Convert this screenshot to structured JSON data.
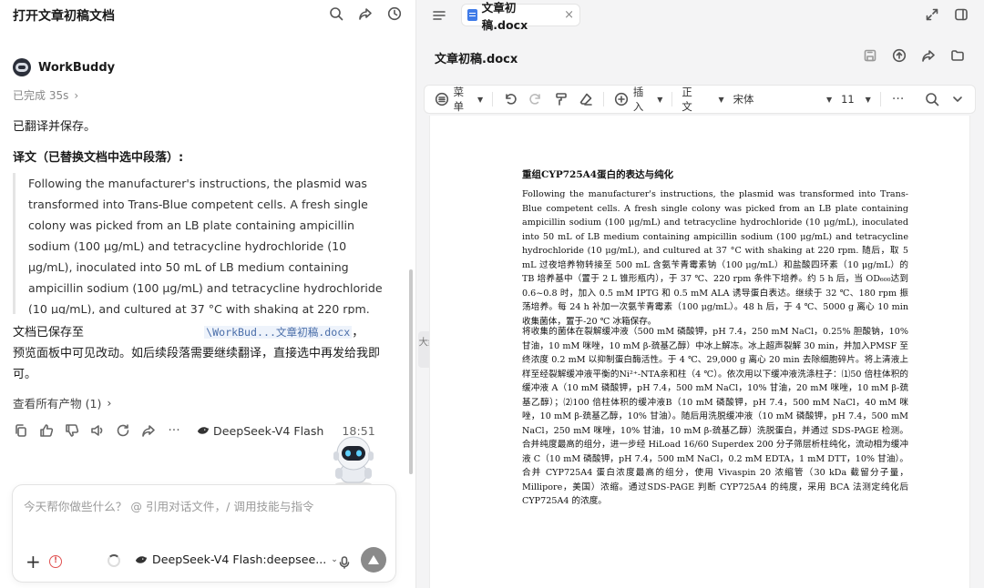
{
  "left": {
    "header_title": "打开文章初稿文档",
    "agent_name": "WorkBuddy",
    "status": "已完成 35s",
    "translated_saved": "已翻译并保存。",
    "translation_heading": "译文（已替换文档中选中段落）:",
    "quote_text": "Following the manufacturer's instructions, the plasmid was transformed into Trans-Blue competent cells. A fresh single colony was picked from an LB plate containing ampicillin sodium (100 μg/mL) and tetracycline hydrochloride (10 μg/mL), inoculated into 50 mL of LB medium containing ampicillin sodium (100 μg/mL) and tetracycline hydrochloride (10 μg/mL), and cultured at 37 °C with shaking at 220 rpm.",
    "saved_prefix": "文档已保存至",
    "saved_path": "\\WorkBud...文章初稿.docx",
    "saved_suffix": "，",
    "saved_line2": "预览面板中可见改动。如后续段落需要继续翻译，直接选中再发给我即可。",
    "products_link": "查看所有产物 (1)",
    "model_name": "DeepSeek-V4 Flash",
    "time": "18:51",
    "composer_placeholder": "今天帮你做些什么？ @ 引用对话文件，/ 调用技能与指令",
    "composer_model": "DeepSeek-V4 Flash:deepsee..."
  },
  "right": {
    "tab_name": "文章初稿.docx",
    "doc_header": "文章初稿.docx",
    "toolbar": {
      "menu": "菜单",
      "insert": "插入",
      "style": "正文",
      "font": "宋体",
      "size": "11"
    },
    "side_tab": "大纲",
    "doc_title": "重组CYP725A4蛋白的表达与纯化",
    "doc_para1": "Following the manufacturer's instructions, the plasmid was transformed into Trans-Blue competent cells. A fresh single colony was picked from an LB plate containing ampicillin sodium (100 μg/mL) and tetracycline hydrochloride (10 μg/mL), inoculated into 50 mL of LB medium containing ampicillin sodium (100 μg/mL) and tetracycline hydrochloride (10 μg/mL), and cultured at 37 °C with shaking at 220 rpm. 随后，取 5 mL 过夜培养物转接至 500 mL 含氨苄青霉素钠（100 μg/mL）和盐酸四环素（10 μg/mL）的 TB 培养基中（置于 2 L 锥形瓶内），于 37 ℃、220 rpm 条件下培养。约 5 h 后，当 OD₆₀₀达到 0.6~0.8 时，加入 0.5 mM IPTG 和 0.5 mM ALA 诱导蛋白表达。继续于 32 ℃、180 rpm 振荡培养。每 24 h 补加一次氨苄青霉素（100 μg/mL）。48 h 后，于 4 ℃、5000 g 离心 10 min 收集菌体，置于-20 ℃ 冰箱保存。",
    "doc_para2": "将收集的菌体在裂解缓冲液（500 mM 磷酸钾，pH 7.4，250 mM NaCl，0.25% 胆酸钠，10% 甘油，10 mM 咪唑，10 mM β-巯基乙醇）中冰上解冻。冰上超声裂解 30 min，并加入PMSF 至终浓度 0.2 mM 以抑制蛋白酶活性。于 4 ℃、29,000 g 离心 20 min 去除细胞碎片。将上清液上样至经裂解缓冲液平衡的Ni²⁺-NTA亲和柱（4 ℃）。依次用以下缓冲液洗涤柱子：⑴50 倍柱体积的缓冲液 A（10 mM 磷酸钾，pH 7.4，500 mM NaCl，10% 甘油，20 mM 咪唑，10 mM β-巯基乙醇）；⑵100 倍柱体积的缓冲液B（10 mM 磷酸钾，pH 7.4，500 mM NaCl，40 mM 咪唑，10 mM β-巯基乙醇，10% 甘油）。随后用洗脱缓冲液（10 mM 磷酸钾，pH 7.4，500 mM NaCl，250 mM 咪唑，10% 甘油，10 mM β-巯基乙醇）洗脱蛋白，并通过 SDS-PAGE 检测。合并纯度最高的组分，进一步经 HiLoad 16/60 Superdex 200 分子筛层析柱纯化，流动相为缓冲液 C（10 mM 磷酸钾，pH 7.4，500 mM NaCl，0.2 mM EDTA，1 mM DTT，10% 甘油）。合并 CYP725A4 蛋白浓度最高的组分，使用 Vivaspin 20 浓缩管（30 kDa 截留分子量，Millipore，美国）浓缩。通过SDS-PAGE 判断 CYP725A4 的纯度，采用 BCA 法测定纯化后 CYP725A4 的浓度。"
  },
  "icons": [
    "search-icon",
    "share-icon",
    "history-icon",
    "menu-icon",
    "expand-icon",
    "window-icon",
    "save-icon",
    "upload-icon",
    "share-icon",
    "folder-icon",
    "copy-icon",
    "thumbs-up-icon",
    "thumbs-down-icon",
    "speaker-icon",
    "refresh-icon",
    "forward-icon",
    "more-icon",
    "undo-icon",
    "redo-icon",
    "format-painter-icon",
    "eraser-icon",
    "plus-circle-icon",
    "mic-icon",
    "send-icon"
  ]
}
